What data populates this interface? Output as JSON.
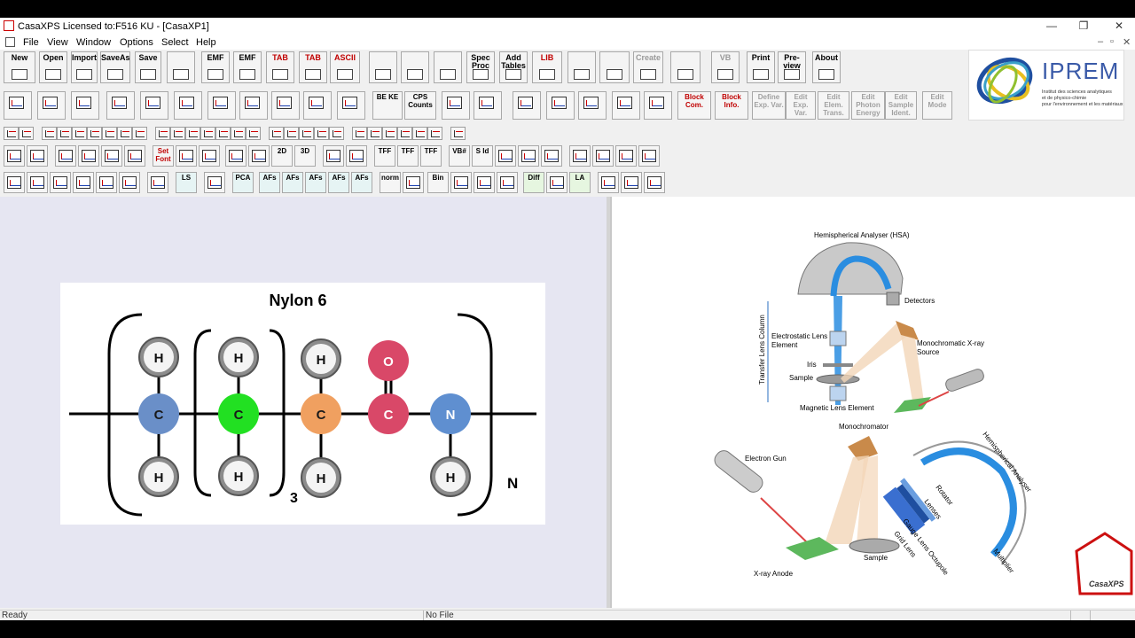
{
  "window": {
    "title": "CasaXPS Licensed to:F516 KU - [CasaXP1]",
    "controls": [
      "—",
      "❐",
      "✕"
    ],
    "mdi_controls": [
      "–",
      "▫",
      "✕"
    ]
  },
  "menu": {
    "items": [
      "File",
      "View",
      "Window",
      "Options",
      "Select",
      "Help"
    ]
  },
  "toolbar_main": {
    "buttons": [
      {
        "label": "New",
        "state": "normal"
      },
      {
        "label": "Open",
        "state": "normal"
      },
      {
        "label": "Import",
        "state": "normal"
      },
      {
        "label": "SaveAs",
        "state": "normal"
      },
      {
        "label": "Save",
        "state": "normal"
      },
      {
        "label": "",
        "state": "normal"
      },
      {
        "label": "EMF",
        "state": "normal"
      },
      {
        "label": "EMF",
        "state": "normal"
      },
      {
        "label": "TAB",
        "state": "red"
      },
      {
        "label": "TAB",
        "state": "red"
      },
      {
        "label": "ASCII",
        "state": "red"
      },
      {
        "label": "",
        "state": "normal"
      },
      {
        "label": "",
        "state": "normal"
      },
      {
        "label": "",
        "state": "normal"
      },
      {
        "label": "Spec Proc",
        "state": "normal"
      },
      {
        "label": "Add Tables",
        "state": "normal"
      },
      {
        "label": "LIB",
        "state": "red"
      },
      {
        "label": "",
        "state": "normal"
      },
      {
        "label": "",
        "state": "normal"
      },
      {
        "label": "Create",
        "state": "disabled"
      },
      {
        "label": "",
        "state": "normal"
      },
      {
        "label": "VB",
        "state": "disabled"
      },
      {
        "label": "Print",
        "state": "normal"
      },
      {
        "label": "Pre-view",
        "state": "normal"
      },
      {
        "label": "About",
        "state": "normal"
      }
    ]
  },
  "toolbar_second": {
    "labels": {
      "be_ke": "BE KE",
      "cps_counts": "CPS Counts",
      "block_com": "Block Com.",
      "block_info": "Block Info.",
      "define_exp_var": "Define Exp. Var.",
      "edit_exp_var": "Edit Exp. Var.",
      "edit_elem_trans": "Edit Elem. Trans.",
      "edit_photon_energy": "Edit Photon Energy",
      "edit_sample_ident": "Edit Sample Ident.",
      "edit_mode": "Edit Mode"
    }
  },
  "toolbar_fourth": {
    "labels": {
      "set_font": "Set Font",
      "two_d": "2D",
      "three_d": "3D",
      "tff1": "TFF",
      "tff2": "TFF",
      "tff3": "TFF",
      "vb_hash": "VB#",
      "s_id": "S Id"
    }
  },
  "toolbar_fifth": {
    "labels": {
      "ls": "LS",
      "pca": "PCA",
      "afs1": "AFs",
      "afs2": "AFs",
      "afs3": "AFs",
      "afs4": "AFs",
      "afs5": "AFs",
      "norm": "norm",
      "bin": "Bin",
      "diff": "Diff",
      "la": "LA"
    }
  },
  "logo": {
    "name": "IPREM",
    "subtitle_lines": [
      "Institut des sciences analytiques",
      "et de physico-chimie",
      "pour l'environnement et les matériaux"
    ]
  },
  "nylon": {
    "title": "Nylon 6",
    "subscript_3": "3",
    "subscript_n": "N",
    "atoms": {
      "h": "H",
      "c": "C",
      "o": "O",
      "n": "N"
    },
    "colors": {
      "carbon_blue": "#6a8fc8",
      "carbon_green": "#22e022",
      "carbon_orange": "#f0a060",
      "carbonyl_red": "#d94868",
      "nitrogen_blue": "#5f8fd0",
      "hydrogen_grey": "#8c8c8c"
    }
  },
  "xps_diagram": {
    "labels": {
      "hsa": "Hemispherical Analyser (HSA)",
      "detectors": "Detectors",
      "electrostatic_lens": "Electrostatic Lens",
      "element": "Element",
      "transfer_lens_column": "Transfer Lens Column",
      "iris": "Iris",
      "sample": "Sample",
      "magnetic_lens": "Magnetic Lens Element",
      "mono_xray_1": "Monochromatic X-ray",
      "mono_xray_2": "Source",
      "monochromator": "Monochromator",
      "electron_gun": "Electron Gun",
      "xray_anode": "X-ray Anode",
      "sample2": "Sample",
      "hemispherical_analyser": "Hemispherical Analyser",
      "rotator": "Rotator",
      "lenses": "Lenses",
      "gauge_lens_octupole": "Gauge Lens Octupole",
      "grid_lens": "Grid Lens",
      "multiplier": "Multiplier"
    },
    "casaxps_logo": "CasaXPS"
  },
  "status": {
    "left": "Ready",
    "file": "No File"
  }
}
